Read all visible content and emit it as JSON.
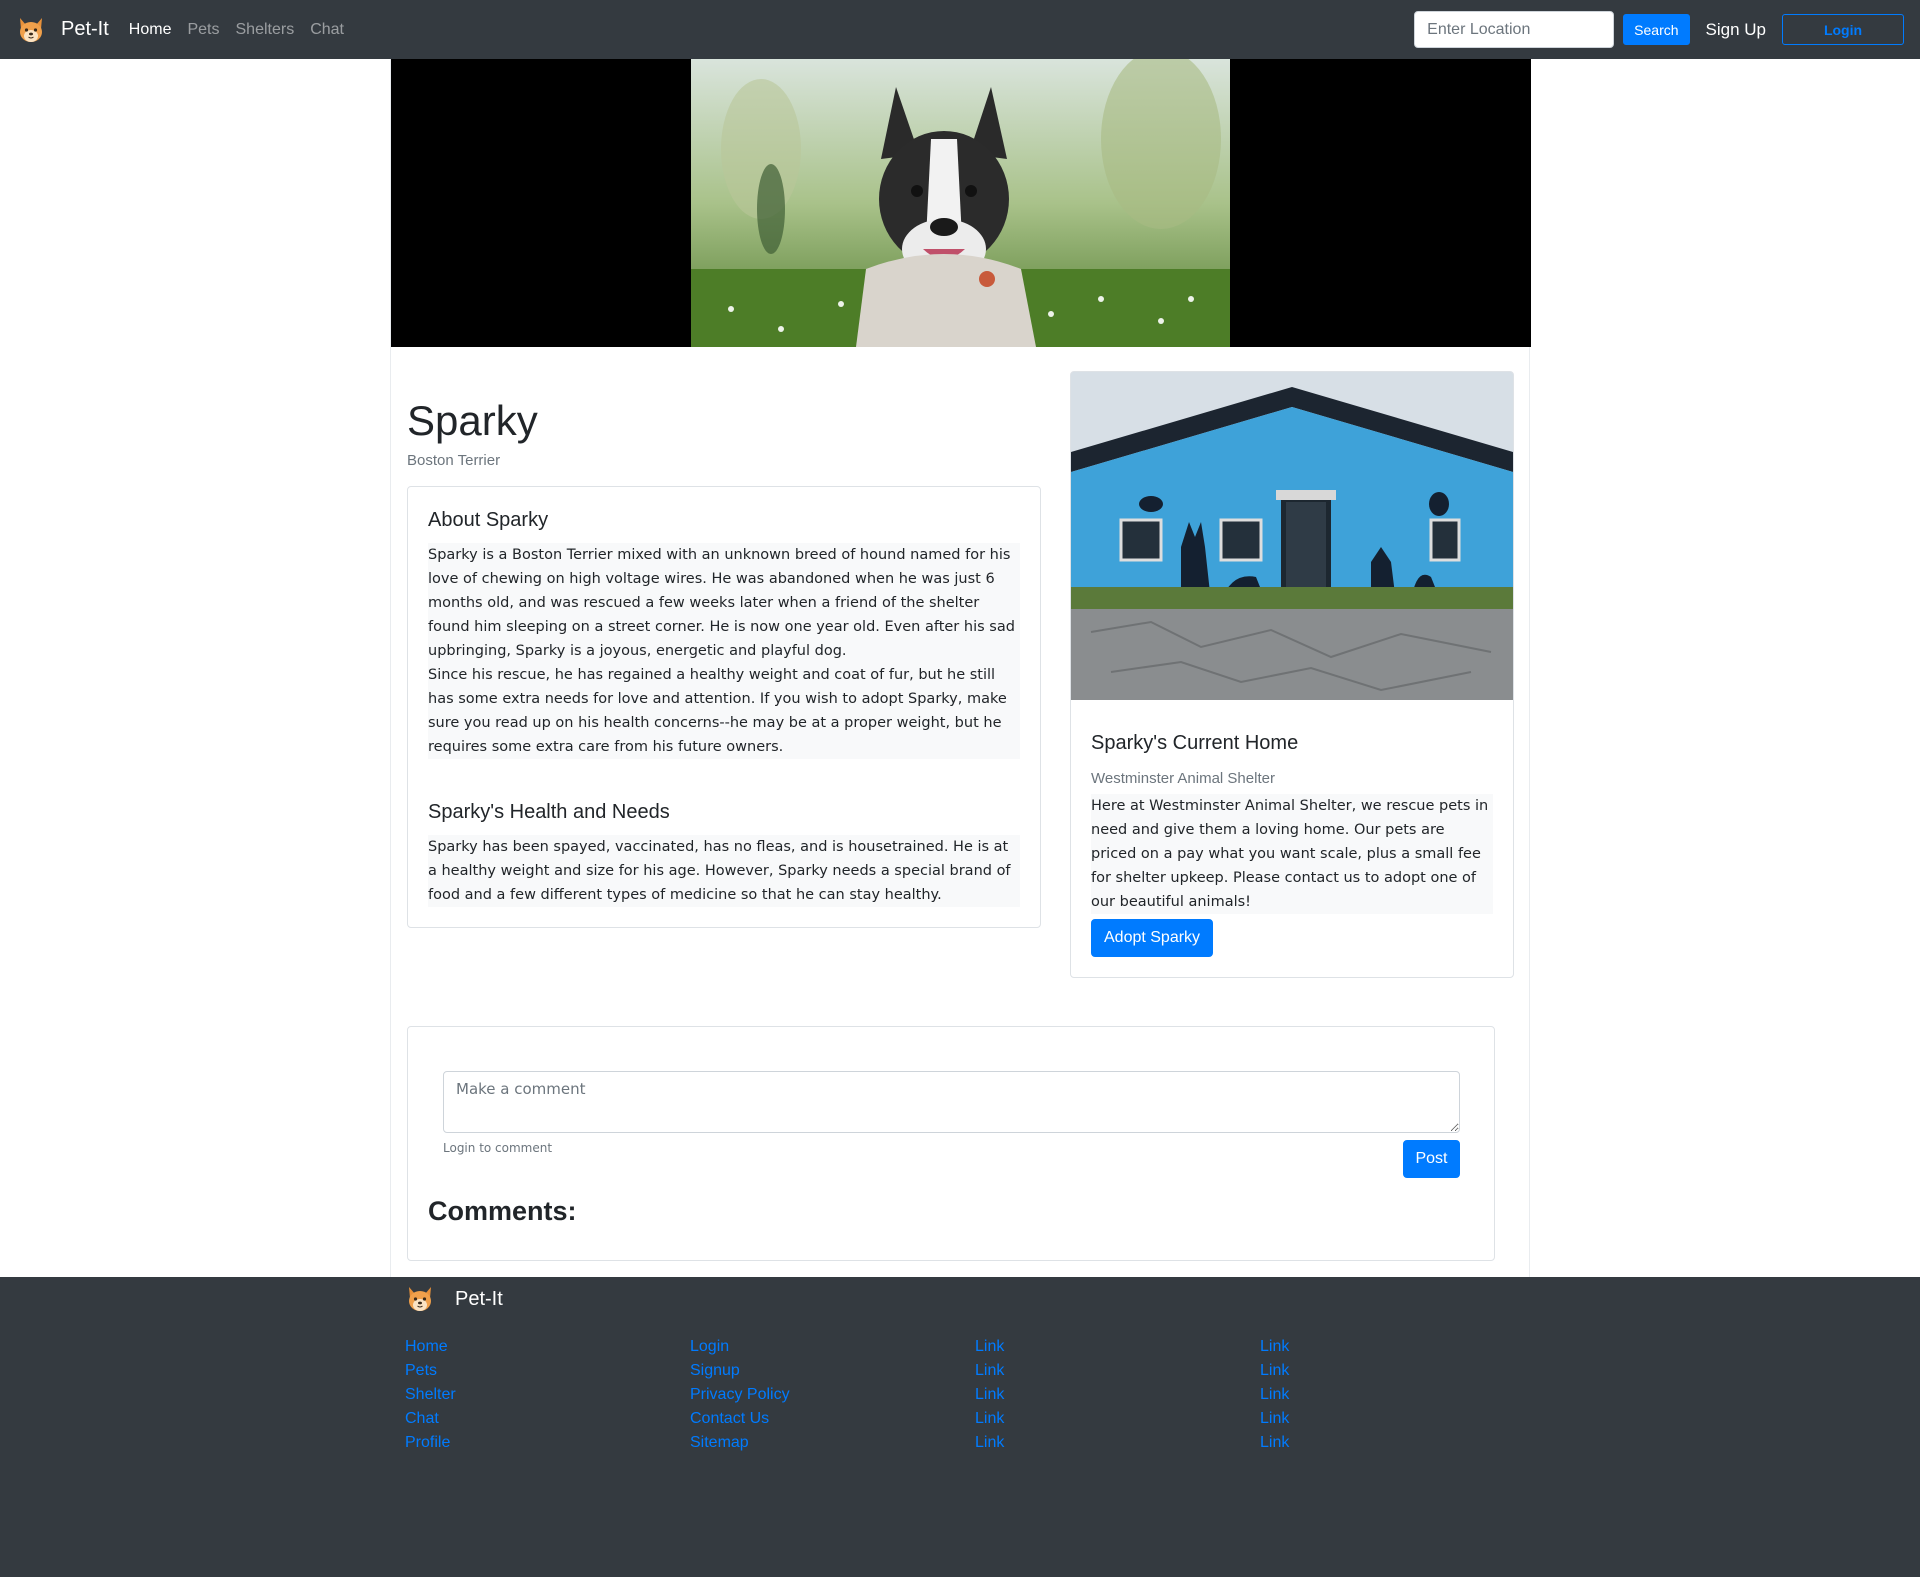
{
  "nav": {
    "brand": "Pet-It",
    "links": [
      "Home",
      "Pets",
      "Shelters",
      "Chat"
    ],
    "search_placeholder": "Enter Location",
    "search_label": "Search",
    "signup_label": "Sign Up",
    "login_label": "Login"
  },
  "pet": {
    "name": "Sparky",
    "breed": "Boston Terrier"
  },
  "about": {
    "heading": "About Sparky",
    "paragraphs": [
      "Sparky is a Boston Terrier mixed with an unknown breed of hound named for his love of chewing on high voltage wires. He was abandoned when he was just 6 months old, and was rescued a few weeks later when a friend of the shelter found him sleeping on a street corner. He is now one year old. Even after his sad upbringing, Sparky is a joyous, energetic and playful dog.",
      "Since his rescue, he has regained a healthy weight and coat of fur, but he still has some extra needs for love and attention. If you wish to adopt Sparky, make sure you read up on his health concerns--he may be at a proper weight, but he requires some extra care from his future owners."
    ]
  },
  "health": {
    "heading": "Sparky's Health and Needs",
    "text": "Sparky has been spayed, vaccinated, has no fleas, and is housetrained. He is at a healthy weight and size for his age. However, Sparky needs a special brand of food and a few different types of medicine so that he can stay healthy."
  },
  "shelter": {
    "heading": "Sparky's Current Home",
    "name": "Westminster Animal Shelter",
    "text": "Here at Westminster Animal Shelter, we rescue pets in need and give them a loving home. Our pets are priced on a pay what you want scale, plus a small fee for shelter upkeep. Please contact us to adopt one of our beautiful animals!",
    "adopt_label": "Adopt Sparky"
  },
  "comments": {
    "placeholder": "Make a comment",
    "hint": "Login to comment",
    "post_label": "Post",
    "heading": "Comments:"
  },
  "footer": {
    "brand": "Pet-It",
    "columns": [
      [
        "Home",
        "Pets",
        "Shelter",
        "Chat",
        "Profile"
      ],
      [
        "Login",
        "Signup",
        "Privacy Policy",
        "Contact Us",
        "Sitemap"
      ],
      [
        "Link",
        "Link",
        "Link",
        "Link",
        "Link"
      ],
      [
        "Link",
        "Link",
        "Link",
        "Link",
        "Link"
      ]
    ]
  },
  "colors": {
    "navbar_bg": "#343a40",
    "primary": "#007bff",
    "muted": "#6c757d",
    "text_bg": "#f8f9fa"
  }
}
